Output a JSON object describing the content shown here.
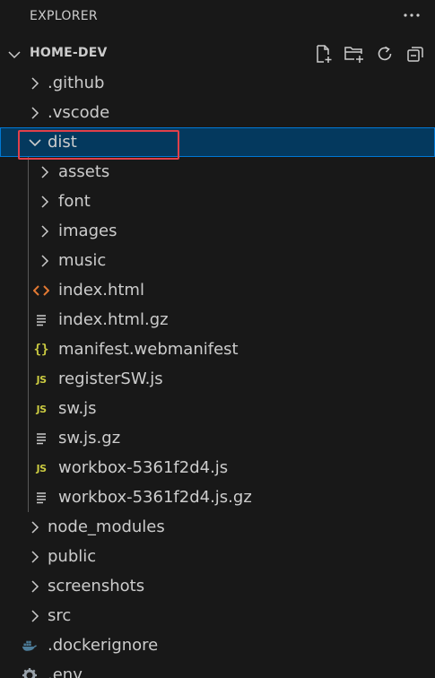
{
  "view": {
    "title": "EXPLORER",
    "more_icon": "ellipsis-icon"
  },
  "section": {
    "title": "HOME-DEV",
    "actions": [
      "new-file-icon",
      "new-folder-icon",
      "refresh-icon",
      "collapse-all-icon"
    ]
  },
  "tree": [
    {
      "label": ".github",
      "kind": "folder",
      "expanded": false,
      "depth": 0
    },
    {
      "label": ".vscode",
      "kind": "folder",
      "expanded": false,
      "depth": 0
    },
    {
      "label": "dist",
      "kind": "folder",
      "expanded": true,
      "depth": 0,
      "selected": true
    },
    {
      "label": "assets",
      "kind": "folder",
      "expanded": false,
      "depth": 1
    },
    {
      "label": "font",
      "kind": "folder",
      "expanded": false,
      "depth": 1
    },
    {
      "label": "images",
      "kind": "folder",
      "expanded": false,
      "depth": 1
    },
    {
      "label": "music",
      "kind": "folder",
      "expanded": false,
      "depth": 1
    },
    {
      "label": "index.html",
      "kind": "html-file",
      "depth": 1
    },
    {
      "label": "index.html.gz",
      "kind": "text-file",
      "depth": 1
    },
    {
      "label": "manifest.webmanifest",
      "kind": "json-file",
      "depth": 1
    },
    {
      "label": "registerSW.js",
      "kind": "js-file",
      "depth": 1
    },
    {
      "label": "sw.js",
      "kind": "js-file",
      "depth": 1
    },
    {
      "label": "sw.js.gz",
      "kind": "text-file",
      "depth": 1
    },
    {
      "label": "workbox-5361f2d4.js",
      "kind": "js-file",
      "depth": 1
    },
    {
      "label": "workbox-5361f2d4.js.gz",
      "kind": "text-file",
      "depth": 1
    },
    {
      "label": "node_modules",
      "kind": "folder",
      "expanded": false,
      "depth": 0
    },
    {
      "label": "public",
      "kind": "folder",
      "expanded": false,
      "depth": 0
    },
    {
      "label": "screenshots",
      "kind": "folder",
      "expanded": false,
      "depth": 0
    },
    {
      "label": "src",
      "kind": "folder",
      "expanded": false,
      "depth": 0
    },
    {
      "label": ".dockerignore",
      "kind": "docker-file",
      "depth": 0
    },
    {
      "label": ".env",
      "kind": "settings-file",
      "depth": 0
    }
  ],
  "colors": {
    "background": "#181818",
    "selection": "#04395e",
    "selection_border": "#0078d4",
    "highlight": "#e0404a",
    "html_icon": "#e37933",
    "js_icon": "#cbcb41",
    "docker_icon": "#4d7d9a"
  }
}
